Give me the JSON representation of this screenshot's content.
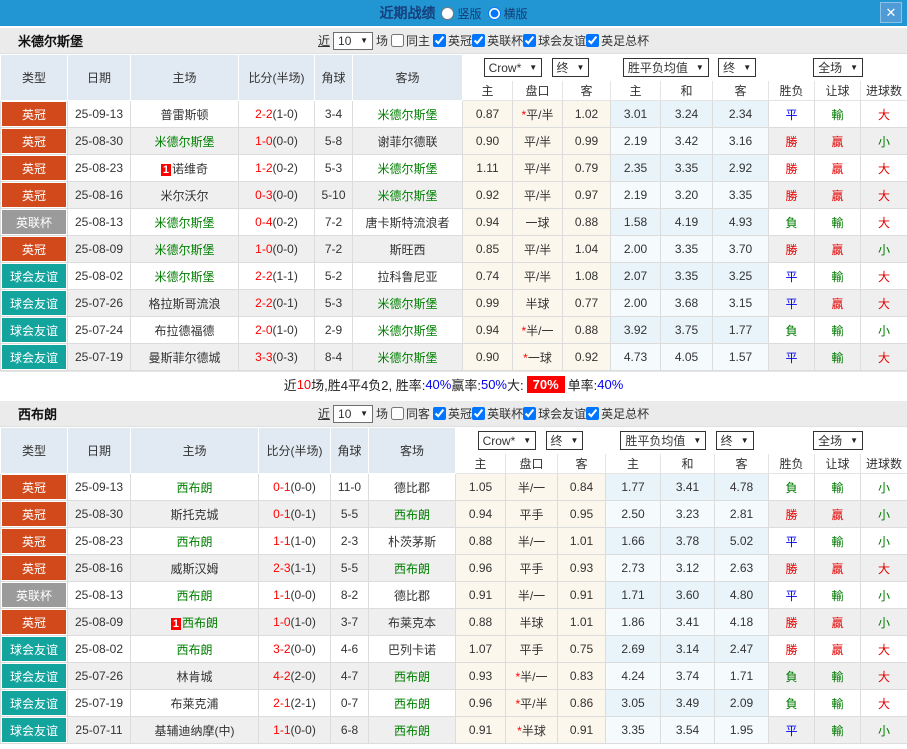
{
  "titlebar": {
    "title": "近期战绩",
    "radio_vertical": "竖版",
    "radio_horizontal": "横版",
    "vertical_checked": false,
    "horizontal_checked": true,
    "close": "✕"
  },
  "table": {
    "col_type": "类型",
    "col_date": "日期",
    "col_home": "主场",
    "col_score": "比分(半场)",
    "col_corner": "角球",
    "col_away": "客场",
    "dd_crow": "Crow*",
    "dd_final": "终",
    "dd_avg": "胜平负均值",
    "dd_full": "全场",
    "sub_ah_home": "主",
    "sub_ah_line": "盘口",
    "sub_ah_away": "客",
    "sub_eu_home": "主",
    "sub_eu_draw": "和",
    "sub_eu_away": "客",
    "sub_res_wdl": "胜负",
    "sub_res_ah": "让球",
    "sub_res_ou": "进球数"
  },
  "colors": {
    "topbar": "#2196d3",
    "league_orange": "#d2491b",
    "league_gray": "#9b9b9b",
    "league_teal": "#13a49e"
  },
  "sections": [
    {
      "team": "米德尔斯堡",
      "filter": {
        "near": "近",
        "count": "10",
        "unit": "场",
        "same_label": "同主",
        "same_checked": false,
        "leagues": [
          {
            "label": "英冠",
            "checked": true
          },
          {
            "label": "英联杯",
            "checked": true
          },
          {
            "label": "球会友谊",
            "checked": true
          },
          {
            "label": "英足总杯",
            "checked": true
          }
        ]
      },
      "rows": [
        {
          "league": "英冠",
          "league_color": "orange",
          "date": "25-09-13",
          "home": "普雷斯顿",
          "home_green": false,
          "home_rank": "",
          "ft": "2-2",
          "ht": "(1-0)",
          "corner": "3-4",
          "away": "米德尔斯堡",
          "away_green": true,
          "away_rank": "",
          "ah_home": "0.87",
          "ah_star": "*",
          "ah_line": "平/半",
          "ah_away": "1.02",
          "eu_home": "3.01",
          "eu_draw": "3.24",
          "eu_away": "2.34",
          "r_wdl": "平",
          "r_wdl_c": "blue",
          "r_ah": "輸",
          "r_ah_c": "green",
          "r_ou": "大",
          "r_ou_c": "red"
        },
        {
          "league": "英冠",
          "league_color": "orange",
          "date": "25-08-30",
          "home": "米德尔斯堡",
          "home_green": true,
          "home_rank": "",
          "ft": "1-0",
          "ht": "(0-0)",
          "corner": "5-8",
          "away": "谢菲尔德联",
          "away_green": false,
          "away_rank": "",
          "ah_home": "0.90",
          "ah_star": "",
          "ah_line": "平/半",
          "ah_away": "0.99",
          "eu_home": "2.19",
          "eu_draw": "3.42",
          "eu_away": "3.16",
          "r_wdl": "勝",
          "r_wdl_c": "red",
          "r_ah": "贏",
          "r_ah_c": "red",
          "r_ou": "小",
          "r_ou_c": "green"
        },
        {
          "league": "英冠",
          "league_color": "orange",
          "date": "25-08-23",
          "home": "诺维奇",
          "home_green": false,
          "home_rank": "1",
          "ft": "1-2",
          "ht": "(0-2)",
          "corner": "5-3",
          "away": "米德尔斯堡",
          "away_green": true,
          "away_rank": "",
          "ah_home": "1.11",
          "ah_star": "",
          "ah_line": "平/半",
          "ah_away": "0.79",
          "eu_home": "2.35",
          "eu_draw": "3.35",
          "eu_away": "2.92",
          "r_wdl": "勝",
          "r_wdl_c": "red",
          "r_ah": "贏",
          "r_ah_c": "red",
          "r_ou": "大",
          "r_ou_c": "red"
        },
        {
          "league": "英冠",
          "league_color": "orange",
          "date": "25-08-16",
          "home": "米尔沃尔",
          "home_green": false,
          "home_rank": "",
          "ft": "0-3",
          "ht": "(0-0)",
          "corner": "5-10",
          "away": "米德尔斯堡",
          "away_green": true,
          "away_rank": "",
          "ah_home": "0.92",
          "ah_star": "",
          "ah_line": "平/半",
          "ah_away": "0.97",
          "eu_home": "2.19",
          "eu_draw": "3.20",
          "eu_away": "3.35",
          "r_wdl": "勝",
          "r_wdl_c": "red",
          "r_ah": "贏",
          "r_ah_c": "red",
          "r_ou": "大",
          "r_ou_c": "red"
        },
        {
          "league": "英联杯",
          "league_color": "gray",
          "date": "25-08-13",
          "home": "米德尔斯堡",
          "home_green": true,
          "home_rank": "",
          "ft": "0-4",
          "ht": "(0-2)",
          "corner": "7-2",
          "away": "唐卡斯特流浪者",
          "away_green": false,
          "away_rank": "",
          "ah_home": "0.94",
          "ah_star": "",
          "ah_line": "一球",
          "ah_away": "0.88",
          "eu_home": "1.58",
          "eu_draw": "4.19",
          "eu_away": "4.93",
          "r_wdl": "負",
          "r_wdl_c": "green",
          "r_ah": "輸",
          "r_ah_c": "green",
          "r_ou": "大",
          "r_ou_c": "red"
        },
        {
          "league": "英冠",
          "league_color": "orange",
          "date": "25-08-09",
          "home": "米德尔斯堡",
          "home_green": true,
          "home_rank": "",
          "ft": "1-0",
          "ht": "(0-0)",
          "corner": "7-2",
          "away": "斯旺西",
          "away_green": false,
          "away_rank": "",
          "ah_home": "0.85",
          "ah_star": "",
          "ah_line": "平/半",
          "ah_away": "1.04",
          "eu_home": "2.00",
          "eu_draw": "3.35",
          "eu_away": "3.70",
          "r_wdl": "勝",
          "r_wdl_c": "red",
          "r_ah": "贏",
          "r_ah_c": "red",
          "r_ou": "小",
          "r_ou_c": "green"
        },
        {
          "league": "球会友谊",
          "league_color": "teal",
          "date": "25-08-02",
          "home": "米德尔斯堡",
          "home_green": true,
          "home_rank": "",
          "ft": "2-2",
          "ht": "(1-1)",
          "corner": "5-2",
          "away": "拉科鲁尼亚",
          "away_green": false,
          "away_rank": "",
          "ah_home": "0.74",
          "ah_star": "",
          "ah_line": "平/半",
          "ah_away": "1.08",
          "eu_home": "2.07",
          "eu_draw": "3.35",
          "eu_away": "3.25",
          "r_wdl": "平",
          "r_wdl_c": "blue",
          "r_ah": "輸",
          "r_ah_c": "green",
          "r_ou": "大",
          "r_ou_c": "red"
        },
        {
          "league": "球会友谊",
          "league_color": "teal",
          "date": "25-07-26",
          "home": "格拉斯哥流浪",
          "home_green": false,
          "home_rank": "",
          "ft": "2-2",
          "ht": "(0-1)",
          "corner": "5-3",
          "away": "米德尔斯堡",
          "away_green": true,
          "away_rank": "",
          "ah_home": "0.99",
          "ah_star": "",
          "ah_line": "半球",
          "ah_away": "0.77",
          "eu_home": "2.00",
          "eu_draw": "3.68",
          "eu_away": "3.15",
          "r_wdl": "平",
          "r_wdl_c": "blue",
          "r_ah": "贏",
          "r_ah_c": "red",
          "r_ou": "大",
          "r_ou_c": "red"
        },
        {
          "league": "球会友谊",
          "league_color": "teal",
          "date": "25-07-24",
          "home": "布拉德福德",
          "home_green": false,
          "home_rank": "",
          "ft": "2-0",
          "ht": "(1-0)",
          "corner": "2-9",
          "away": "米德尔斯堡",
          "away_green": true,
          "away_rank": "",
          "ah_home": "0.94",
          "ah_star": "*",
          "ah_line": "半/一",
          "ah_away": "0.88",
          "eu_home": "3.92",
          "eu_draw": "3.75",
          "eu_away": "1.77",
          "r_wdl": "負",
          "r_wdl_c": "green",
          "r_ah": "輸",
          "r_ah_c": "green",
          "r_ou": "小",
          "r_ou_c": "green"
        },
        {
          "league": "球会友谊",
          "league_color": "teal",
          "date": "25-07-19",
          "home": "曼斯菲尔德城",
          "home_green": false,
          "home_rank": "",
          "ft": "3-3",
          "ht": "(0-3)",
          "corner": "8-4",
          "away": "米德尔斯堡",
          "away_green": true,
          "away_rank": "",
          "ah_home": "0.90",
          "ah_star": "*",
          "ah_line": "一球",
          "ah_away": "0.92",
          "eu_home": "4.73",
          "eu_draw": "4.05",
          "eu_away": "1.57",
          "r_wdl": "平",
          "r_wdl_c": "blue",
          "r_ah": "輸",
          "r_ah_c": "green",
          "r_ou": "大",
          "r_ou_c": "red"
        }
      ],
      "summary": [
        {
          "text": "近",
          "style": "plain"
        },
        {
          "text": "10",
          "style": "red"
        },
        {
          "text": "场,胜4平4负2, 胜率:",
          "style": "plain"
        },
        {
          "text": "40%",
          "style": "blue"
        },
        {
          "text": " 赢率:",
          "style": "plain"
        },
        {
          "text": "50%",
          "style": "blue"
        },
        {
          "text": " 大:",
          "style": "plain"
        },
        {
          "text": "70%",
          "style": "badge"
        },
        {
          "text": " 单率:",
          "style": "plain"
        },
        {
          "text": "40%",
          "style": "blue"
        }
      ]
    },
    {
      "team": "西布朗",
      "filter": {
        "near": "近",
        "count": "10",
        "unit": "场",
        "same_label": "同客",
        "same_checked": false,
        "leagues": [
          {
            "label": "英冠",
            "checked": true
          },
          {
            "label": "英联杯",
            "checked": true
          },
          {
            "label": "球会友谊",
            "checked": true
          },
          {
            "label": "英足总杯",
            "checked": true
          }
        ]
      },
      "rows": [
        {
          "league": "英冠",
          "league_color": "orange",
          "date": "25-09-13",
          "home": "西布朗",
          "home_green": true,
          "home_rank": "",
          "ft": "0-1",
          "ht": "(0-0)",
          "corner": "11-0",
          "away": "德比郡",
          "away_green": false,
          "away_rank": "",
          "ah_home": "1.05",
          "ah_star": "",
          "ah_line": "半/一",
          "ah_away": "0.84",
          "eu_home": "1.77",
          "eu_draw": "3.41",
          "eu_away": "4.78",
          "r_wdl": "負",
          "r_wdl_c": "green",
          "r_ah": "輸",
          "r_ah_c": "green",
          "r_ou": "小",
          "r_ou_c": "green"
        },
        {
          "league": "英冠",
          "league_color": "orange",
          "date": "25-08-30",
          "home": "斯托克城",
          "home_green": false,
          "home_rank": "",
          "ft": "0-1",
          "ht": "(0-1)",
          "corner": "5-5",
          "away": "西布朗",
          "away_green": true,
          "away_rank": "",
          "ah_home": "0.94",
          "ah_star": "",
          "ah_line": "平手",
          "ah_away": "0.95",
          "eu_home": "2.50",
          "eu_draw": "3.23",
          "eu_away": "2.81",
          "r_wdl": "勝",
          "r_wdl_c": "red",
          "r_ah": "贏",
          "r_ah_c": "red",
          "r_ou": "小",
          "r_ou_c": "green"
        },
        {
          "league": "英冠",
          "league_color": "orange",
          "date": "25-08-23",
          "home": "西布朗",
          "home_green": true,
          "home_rank": "",
          "ft": "1-1",
          "ht": "(1-0)",
          "corner": "2-3",
          "away": "朴茨茅斯",
          "away_green": false,
          "away_rank": "",
          "ah_home": "0.88",
          "ah_star": "",
          "ah_line": "半/一",
          "ah_away": "1.01",
          "eu_home": "1.66",
          "eu_draw": "3.78",
          "eu_away": "5.02",
          "r_wdl": "平",
          "r_wdl_c": "blue",
          "r_ah": "輸",
          "r_ah_c": "green",
          "r_ou": "小",
          "r_ou_c": "green"
        },
        {
          "league": "英冠",
          "league_color": "orange",
          "date": "25-08-16",
          "home": "威斯汉姆",
          "home_green": false,
          "home_rank": "",
          "ft": "2-3",
          "ht": "(1-1)",
          "corner": "5-5",
          "away": "西布朗",
          "away_green": true,
          "away_rank": "",
          "ah_home": "0.96",
          "ah_star": "",
          "ah_line": "平手",
          "ah_away": "0.93",
          "eu_home": "2.73",
          "eu_draw": "3.12",
          "eu_away": "2.63",
          "r_wdl": "勝",
          "r_wdl_c": "red",
          "r_ah": "贏",
          "r_ah_c": "red",
          "r_ou": "大",
          "r_ou_c": "red"
        },
        {
          "league": "英联杯",
          "league_color": "gray",
          "date": "25-08-13",
          "home": "西布朗",
          "home_green": true,
          "home_rank": "",
          "ft": "1-1",
          "ht": "(0-0)",
          "corner": "8-2",
          "away": "德比郡",
          "away_green": false,
          "away_rank": "",
          "ah_home": "0.91",
          "ah_star": "",
          "ah_line": "半/一",
          "ah_away": "0.91",
          "eu_home": "1.71",
          "eu_draw": "3.60",
          "eu_away": "4.80",
          "r_wdl": "平",
          "r_wdl_c": "blue",
          "r_ah": "輸",
          "r_ah_c": "green",
          "r_ou": "小",
          "r_ou_c": "green"
        },
        {
          "league": "英冠",
          "league_color": "orange",
          "date": "25-08-09",
          "home": "西布朗",
          "home_green": true,
          "home_rank": "1",
          "ft": "1-0",
          "ht": "(1-0)",
          "corner": "3-7",
          "away": "布莱克本",
          "away_green": false,
          "away_rank": "",
          "ah_home": "0.88",
          "ah_star": "",
          "ah_line": "半球",
          "ah_away": "1.01",
          "eu_home": "1.86",
          "eu_draw": "3.41",
          "eu_away": "4.18",
          "r_wdl": "勝",
          "r_wdl_c": "red",
          "r_ah": "贏",
          "r_ah_c": "red",
          "r_ou": "小",
          "r_ou_c": "green"
        },
        {
          "league": "球会友谊",
          "league_color": "teal",
          "date": "25-08-02",
          "home": "西布朗",
          "home_green": true,
          "home_rank": "",
          "ft": "3-2",
          "ht": "(0-0)",
          "corner": "4-6",
          "away": "巴列卡诺",
          "away_green": false,
          "away_rank": "",
          "ah_home": "1.07",
          "ah_star": "",
          "ah_line": "平手",
          "ah_away": "0.75",
          "eu_home": "2.69",
          "eu_draw": "3.14",
          "eu_away": "2.47",
          "r_wdl": "勝",
          "r_wdl_c": "red",
          "r_ah": "贏",
          "r_ah_c": "red",
          "r_ou": "大",
          "r_ou_c": "red"
        },
        {
          "league": "球会友谊",
          "league_color": "teal",
          "date": "25-07-26",
          "home": "林肯城",
          "home_green": false,
          "home_rank": "",
          "ft": "4-2",
          "ht": "(2-0)",
          "corner": "4-7",
          "away": "西布朗",
          "away_green": true,
          "away_rank": "",
          "ah_home": "0.93",
          "ah_star": "*",
          "ah_line": "半/一",
          "ah_away": "0.83",
          "eu_home": "4.24",
          "eu_draw": "3.74",
          "eu_away": "1.71",
          "r_wdl": "負",
          "r_wdl_c": "green",
          "r_ah": "輸",
          "r_ah_c": "green",
          "r_ou": "大",
          "r_ou_c": "red"
        },
        {
          "league": "球会友谊",
          "league_color": "teal",
          "date": "25-07-19",
          "home": "布莱克浦",
          "home_green": false,
          "home_rank": "",
          "ft": "2-1",
          "ht": "(2-1)",
          "corner": "0-7",
          "away": "西布朗",
          "away_green": true,
          "away_rank": "",
          "ah_home": "0.96",
          "ah_star": "*",
          "ah_line": "平/半",
          "ah_away": "0.86",
          "eu_home": "3.05",
          "eu_draw": "3.49",
          "eu_away": "2.09",
          "r_wdl": "負",
          "r_wdl_c": "green",
          "r_ah": "輸",
          "r_ah_c": "green",
          "r_ou": "大",
          "r_ou_c": "red"
        },
        {
          "league": "球会友谊",
          "league_color": "teal",
          "date": "25-07-11",
          "home": "基辅迪纳摩(中)",
          "home_green": false,
          "home_rank": "",
          "ft": "1-1",
          "ht": "(0-0)",
          "corner": "6-8",
          "away": "西布朗",
          "away_green": true,
          "away_rank": "",
          "ah_home": "0.91",
          "ah_star": "*",
          "ah_line": "半球",
          "ah_away": "0.91",
          "eu_home": "3.35",
          "eu_draw": "3.54",
          "eu_away": "1.95",
          "r_wdl": "平",
          "r_wdl_c": "blue",
          "r_ah": "輸",
          "r_ah_c": "green",
          "r_ou": "小",
          "r_ou_c": "green"
        }
      ]
    }
  ]
}
